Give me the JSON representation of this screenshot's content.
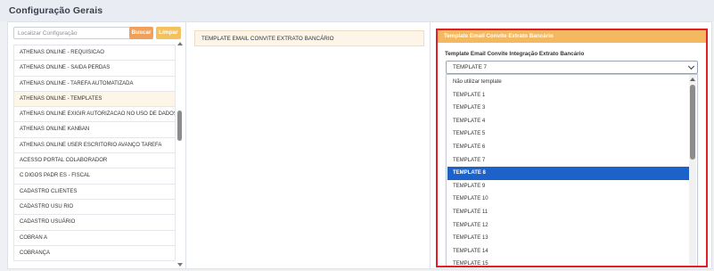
{
  "page": {
    "title": "Configuração Gerais"
  },
  "search": {
    "placeholder": "Localizar Configuração",
    "value": "",
    "search_label": "Buscar",
    "clear_label": "Limpar"
  },
  "config_list": {
    "items": [
      "ATHENAS ONLINE - REQUISICAO",
      "ATHENAS ONLINE - SAIDA PERDAS",
      "ATHENAS ONLINE - TAREFA AUTOMATIZADA",
      "ATHENAS ONLINE - TEMPLATES",
      "ATHENAS ONLINE EXIGIR AUTORIZACAO NO USO DE DADOS",
      "ATHENAS ONLINE KANBAN",
      "ATHENAS ONLINE USER ESCRITORIO AVANÇO TAREFA",
      "ACESSO PORTAL COLABORADOR",
      "C DIGOS PADR ES - FISCAL",
      "CADASTRO CLIENTES",
      "CADASTRO USU RIO",
      "CADASTRO USUÁRIO",
      "COBRAN A",
      "COBRANÇA"
    ],
    "active_index": 3
  },
  "middle": {
    "item_label": "TEMPLATE EMAIL CONVITE EXTRATO BANCÁRIO"
  },
  "detail": {
    "header": "Template Email Convite Extrato Bancário",
    "field_label": "Template Email Convite Integração Extrato Bancário",
    "selected_value": "TEMPLATE 7",
    "options": [
      "Não utilizar template",
      "TEMPLATE 1",
      "TEMPLATE 3",
      "TEMPLATE 4",
      "TEMPLATE 5",
      "TEMPLATE 6",
      "TEMPLATE 7",
      "TEMPLATE 8",
      "TEMPLATE 9",
      "TEMPLATE 10",
      "TEMPLATE 11",
      "TEMPLATE 12",
      "TEMPLATE 13",
      "TEMPLATE 14",
      "TEMPLATE 15"
    ],
    "highlighted_index": 7
  },
  "colors": {
    "accent_orange": "#f4b860",
    "search_button": "#f0a05a",
    "clear_button": "#f3c25e",
    "highlight": "#1d62c9",
    "frame": "#e21f26"
  }
}
